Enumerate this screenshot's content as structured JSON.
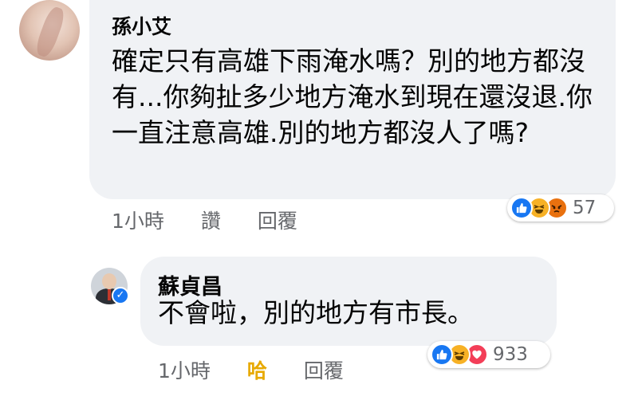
{
  "comment": {
    "author": "孫小艾",
    "text": "確定只有高雄下雨淹水嗎？別的地方都沒有...你夠扯多少地方淹水到現在還沒退.你一直注意高雄.別的地方都沒人了嗎?",
    "time": "1小時",
    "like_label": "讚",
    "reply_label": "回覆",
    "reactions": [
      "like-icon",
      "haha-icon",
      "angry-icon"
    ],
    "reaction_count": "57"
  },
  "reply": {
    "author": "蘇貞昌",
    "verified": true,
    "text": "不會啦，別的地方有市長。",
    "time": "1小時",
    "reaction_label": "哈",
    "reaction_label_color": "#e7a900",
    "reply_label": "回覆",
    "reactions": [
      "like-icon",
      "haha-icon",
      "love-icon"
    ],
    "reaction_count": "933"
  },
  "colors": {
    "bubble": "#f0f2f5",
    "meta_text": "#65676b",
    "brand_blue": "#1877f2"
  }
}
